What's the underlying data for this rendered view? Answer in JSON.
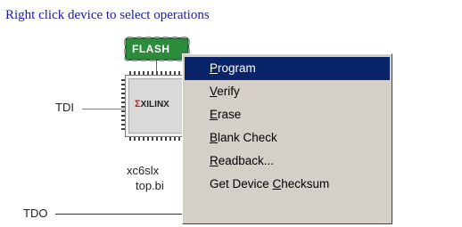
{
  "instruction": "Right click device to select operations",
  "chain": {
    "tdi_label": "TDI",
    "tdo_label": "TDO"
  },
  "flash_device": {
    "label": "FLASH"
  },
  "fpga_device": {
    "logo_text": "XILINX",
    "name": "xc6slx",
    "file": "top.bi"
  },
  "context_menu": {
    "items": [
      {
        "label": "Program",
        "selected": true
      },
      {
        "label": "Verify",
        "selected": false
      },
      {
        "label": "Erase",
        "selected": false
      },
      {
        "label": "Blank Check",
        "selected": false
      },
      {
        "label": "Readback...",
        "selected": false
      },
      {
        "label": "Get Device Checksum",
        "selected": false
      }
    ]
  },
  "colors": {
    "instruction_text": "#1a1aa6",
    "menu_highlight": "#0a246a",
    "menu_background": "#d4d0c8",
    "flash_chip": "#2d8c3c"
  }
}
